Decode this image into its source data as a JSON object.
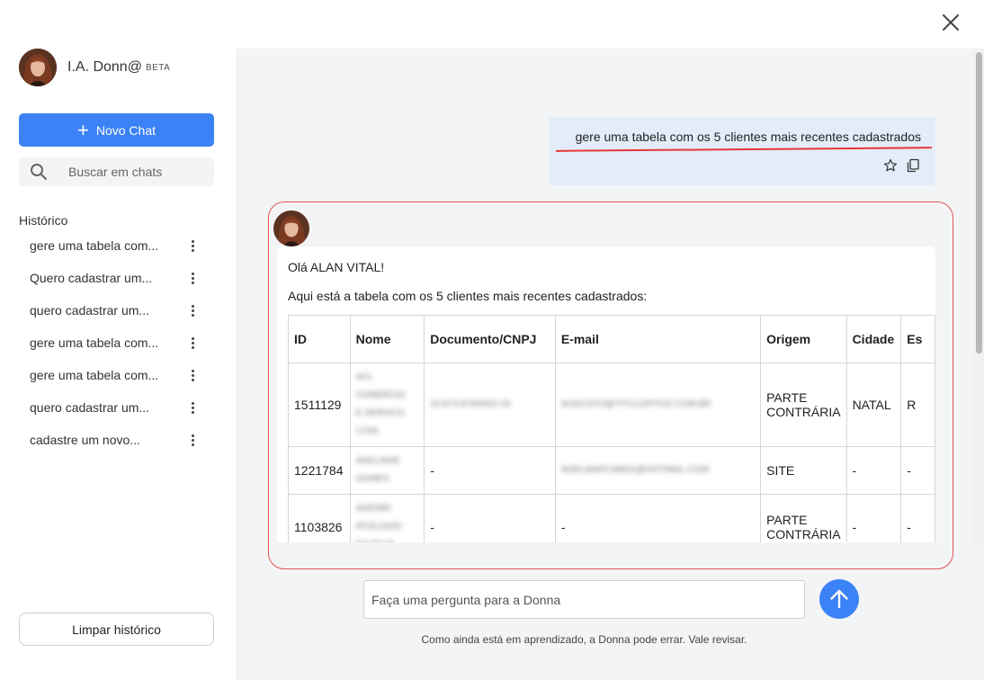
{
  "window": {
    "close_icon": "close-icon"
  },
  "sidebar": {
    "brand_name": "I.A. Donn@",
    "brand_badge": "BETA",
    "new_chat_label": "Novo Chat",
    "search_placeholder": "Buscar em chats",
    "history_title": "Histórico",
    "history": [
      {
        "label": "gere uma tabela com..."
      },
      {
        "label": "Quero cadastrar um..."
      },
      {
        "label": "quero cadastrar um..."
      },
      {
        "label": "gere uma tabela com..."
      },
      {
        "label": "gere uma tabela com..."
      },
      {
        "label": "quero cadastrar um..."
      },
      {
        "label": "cadastre um novo..."
      }
    ],
    "clear_label": "Limpar histórico"
  },
  "chat": {
    "user_message": "gere uma tabela com os 5 clientes mais recentes cadastrados",
    "assistant": {
      "greeting": "Olá ALAN VITAL!",
      "intro": "Aqui está a tabela com os 5 clientes mais recentes cadastrados:",
      "table": {
        "headers": [
          "ID",
          "Nome",
          "Documento/CNPJ",
          "E-mail",
          "Origem",
          "Cidade",
          "Es"
        ],
        "rows": [
          {
            "id": "1511129",
            "origem_line1": "PARTE",
            "origem_line2": "CONTRÁRIA",
            "cidade": "NATAL",
            "estado": "R",
            "documento": "",
            "email": ""
          },
          {
            "id": "1221784",
            "origem_line1": "SITE",
            "origem_line2": "",
            "cidade": "-",
            "estado": "-",
            "documento": "-",
            "email": ""
          },
          {
            "id": "1103826",
            "origem_line1": "PARTE",
            "origem_line2": "CONTRÁRIA",
            "cidade": "-",
            "estado": "-",
            "documento": "-",
            "email": "-"
          }
        ]
      }
    }
  },
  "composer": {
    "placeholder": "Faça uma pergunta para a Donna",
    "disclaimer": "Como ainda está em aprendizado, a Donna pode errar. Vale revisar."
  },
  "colors": {
    "accent": "#3b82f6",
    "highlight": "#e05555",
    "user_bubble": "#e3edf9",
    "main_bg": "#f3f4f6"
  }
}
